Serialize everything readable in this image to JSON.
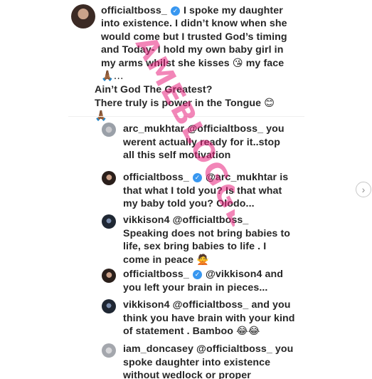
{
  "post": {
    "username": "officialtboss_",
    "caption_line1": "I spoke my daughter",
    "caption_line2": "into existence. I didn’t know when she",
    "caption_line3": "would come but I trusted God’s timing",
    "caption_line4": "and Today- I hold my own baby girl in",
    "caption_line5a": "my arms whilst she kisses",
    "caption_line5b": "my face",
    "caption_line6": "🙏🏾...",
    "caption_line7": "Ain’t God The Greatest?",
    "caption_line8": "There truly is power in the Tongue",
    "caption_emoji_smile": "😊",
    "caption_emoji_kiss": "😘",
    "caption_emoji_pray": "🙏🏾"
  },
  "comments": [
    {
      "username": "arc_mukhtar",
      "mention": "@officialtboss_",
      "line1_rest": "you",
      "line2": "werent actually ready for it..stop",
      "line3": "all this self motivation"
    },
    {
      "username": "officialtboss_",
      "mention": "@arc_mukhtar",
      "line1_rest": "is",
      "line2": "that what I told you? Is that what",
      "line3": "my baby told you? Olodo..."
    },
    {
      "username": "vikkison4",
      "mention": "@officialtboss_",
      "line2": "Speaking does not bring babies to",
      "line3": "life, sex bring babies to life . I",
      "line4": "come in peace",
      "emoji": "🙅"
    },
    {
      "username": "officialtboss_",
      "mention": "@vikkison4",
      "line1_rest": "and",
      "line2": "you left your brain in pieces..."
    },
    {
      "username": "vikkison4",
      "mention": "@officialtboss_",
      "line1_rest": "and you",
      "line2": "think you have brain with your kind",
      "line3": "of statement . Bamboo",
      "emoji": "😂😂"
    },
    {
      "username": "iam_doncasey",
      "mention": "@officialtboss_",
      "line1_rest": "you",
      "line2": "spoke daughter into existence",
      "line3": "without wedlock or proper"
    }
  ],
  "verified_glyph": "✓",
  "watermark_text": "AMEBLOGGER.COM",
  "colors": {
    "text": "#262626",
    "verified_blue": "#3897f0",
    "watermark": "#e8237d"
  },
  "icons": {
    "verified": "verified-badge-icon",
    "next": "chevron-right-icon"
  },
  "next_glyph": "›"
}
